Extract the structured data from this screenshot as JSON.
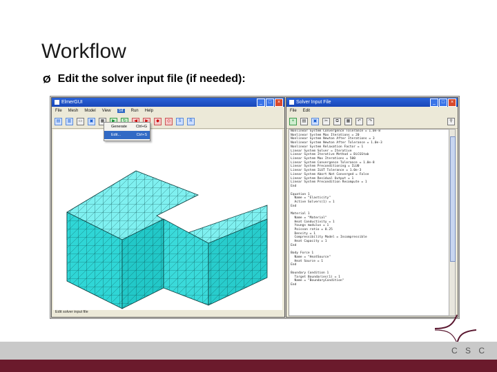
{
  "slide": {
    "title": "Workflow",
    "bullet_marker": "Ø",
    "bullet": "Edit the solver input file (if needed):"
  },
  "gui_window": {
    "title": "ElmerGUI",
    "menu": [
      "File",
      "Mesh",
      "Model",
      "View",
      "Sif",
      "Run",
      "Help"
    ],
    "menu_selected": "Sif",
    "dropdown": [
      {
        "label": "Generate",
        "shortcut": "Ctrl+G"
      },
      {
        "label": "Edit...",
        "shortcut": "Ctrl+S"
      }
    ],
    "status": "Edit solver input file"
  },
  "sif_window": {
    "title": "Solver Input File",
    "menu": [
      "File",
      "Edit"
    ],
    "lines": [
      "Nonlinear System Convergence Tolerance = 1.0e-8",
      "Nonlinear System Max Iterations = 20",
      "Nonlinear System Newton After Iterations = 3",
      "Nonlinear System Newton After Tolerance = 1.0e-3",
      "Nonlinear System Relaxation Factor = 1",
      "Linear System Solver = Iterative",
      "Linear System Iterative Method = BiCGStab",
      "Linear System Max Iterations = 500",
      "Linear System Convergence Tolerance = 1.0e-8",
      "Linear System Preconditioning = ILU0",
      "Linear System ILUT Tolerance = 1.0e-3",
      "Linear System Abort Not Converged = False",
      "Linear System Residual Output = 1",
      "Linear System Precondition Recompute = 1",
      "End",
      "",
      "Equation 1",
      "  Name = \"Elasticity\"",
      "  Active Solvers(1) = 1",
      "End",
      "",
      "Material 1",
      "  Name = \"Material\"",
      "  Heat Conductivity = 1",
      "  Youngs modulus = 1",
      "  Poisson ratio = 0.25",
      "  Density = 1",
      "  Compressibility Model = Incompressible",
      "  Heat Capacity = 1",
      "End",
      "",
      "Body Force 1",
      "  Name = \"HeatSource\"",
      "  Heat Source = 1",
      "End",
      "",
      "Boundary Condition 1",
      "  Target Boundaries(1) = 1",
      "  Name = \"BoundaryCondition\"",
      "End"
    ]
  },
  "footer": {
    "logo_text": "C S C"
  },
  "colors": {
    "mesh_face": "#2fd6d6",
    "footer_red": "#6b1a2c",
    "footer_grey": "#c9c9c9"
  }
}
